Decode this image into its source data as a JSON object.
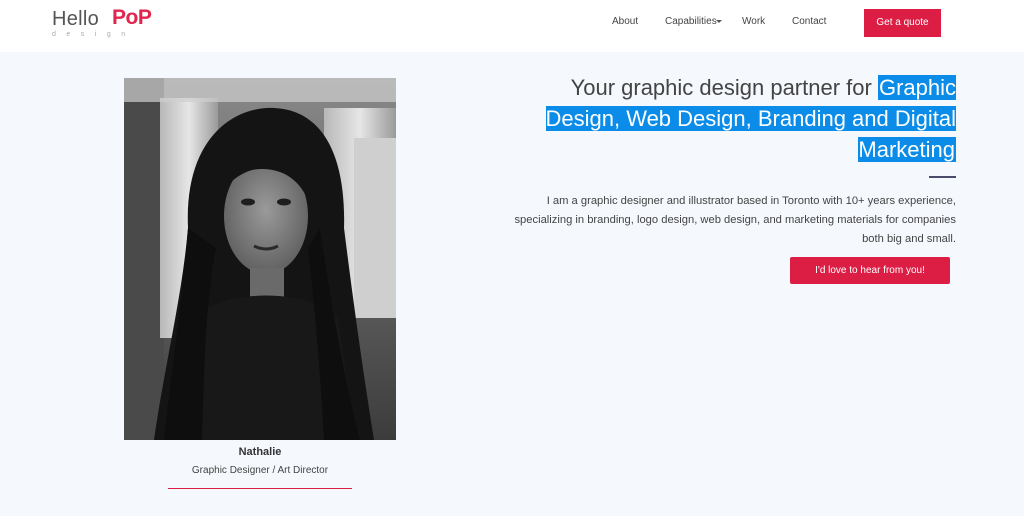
{
  "logo": {
    "hello": "Hello",
    "pop": "PoP",
    "design": "design"
  },
  "nav": {
    "about": "About",
    "capabilities": "Capabilities",
    "work": "Work",
    "contact": "Contact",
    "quote_button": "Get a quote"
  },
  "profile": {
    "name": "Nathalie",
    "title": "Graphic Designer / Art Director"
  },
  "hero": {
    "headline_plain": "Your graphic design partner for ",
    "headline_highlight": "Graphic Design, Web Design, Branding and Digital Marketing",
    "description": "I am a graphic designer and illustrator based in Toronto with 10+ years experience, specializing in branding, logo design, web design, and marketing materials for companies both big and small.",
    "cta_button": "I'd love to hear from you!"
  },
  "colors": {
    "accent": "#dc1e45",
    "highlight": "#0a8ce8",
    "background": "#f5f8fc"
  }
}
